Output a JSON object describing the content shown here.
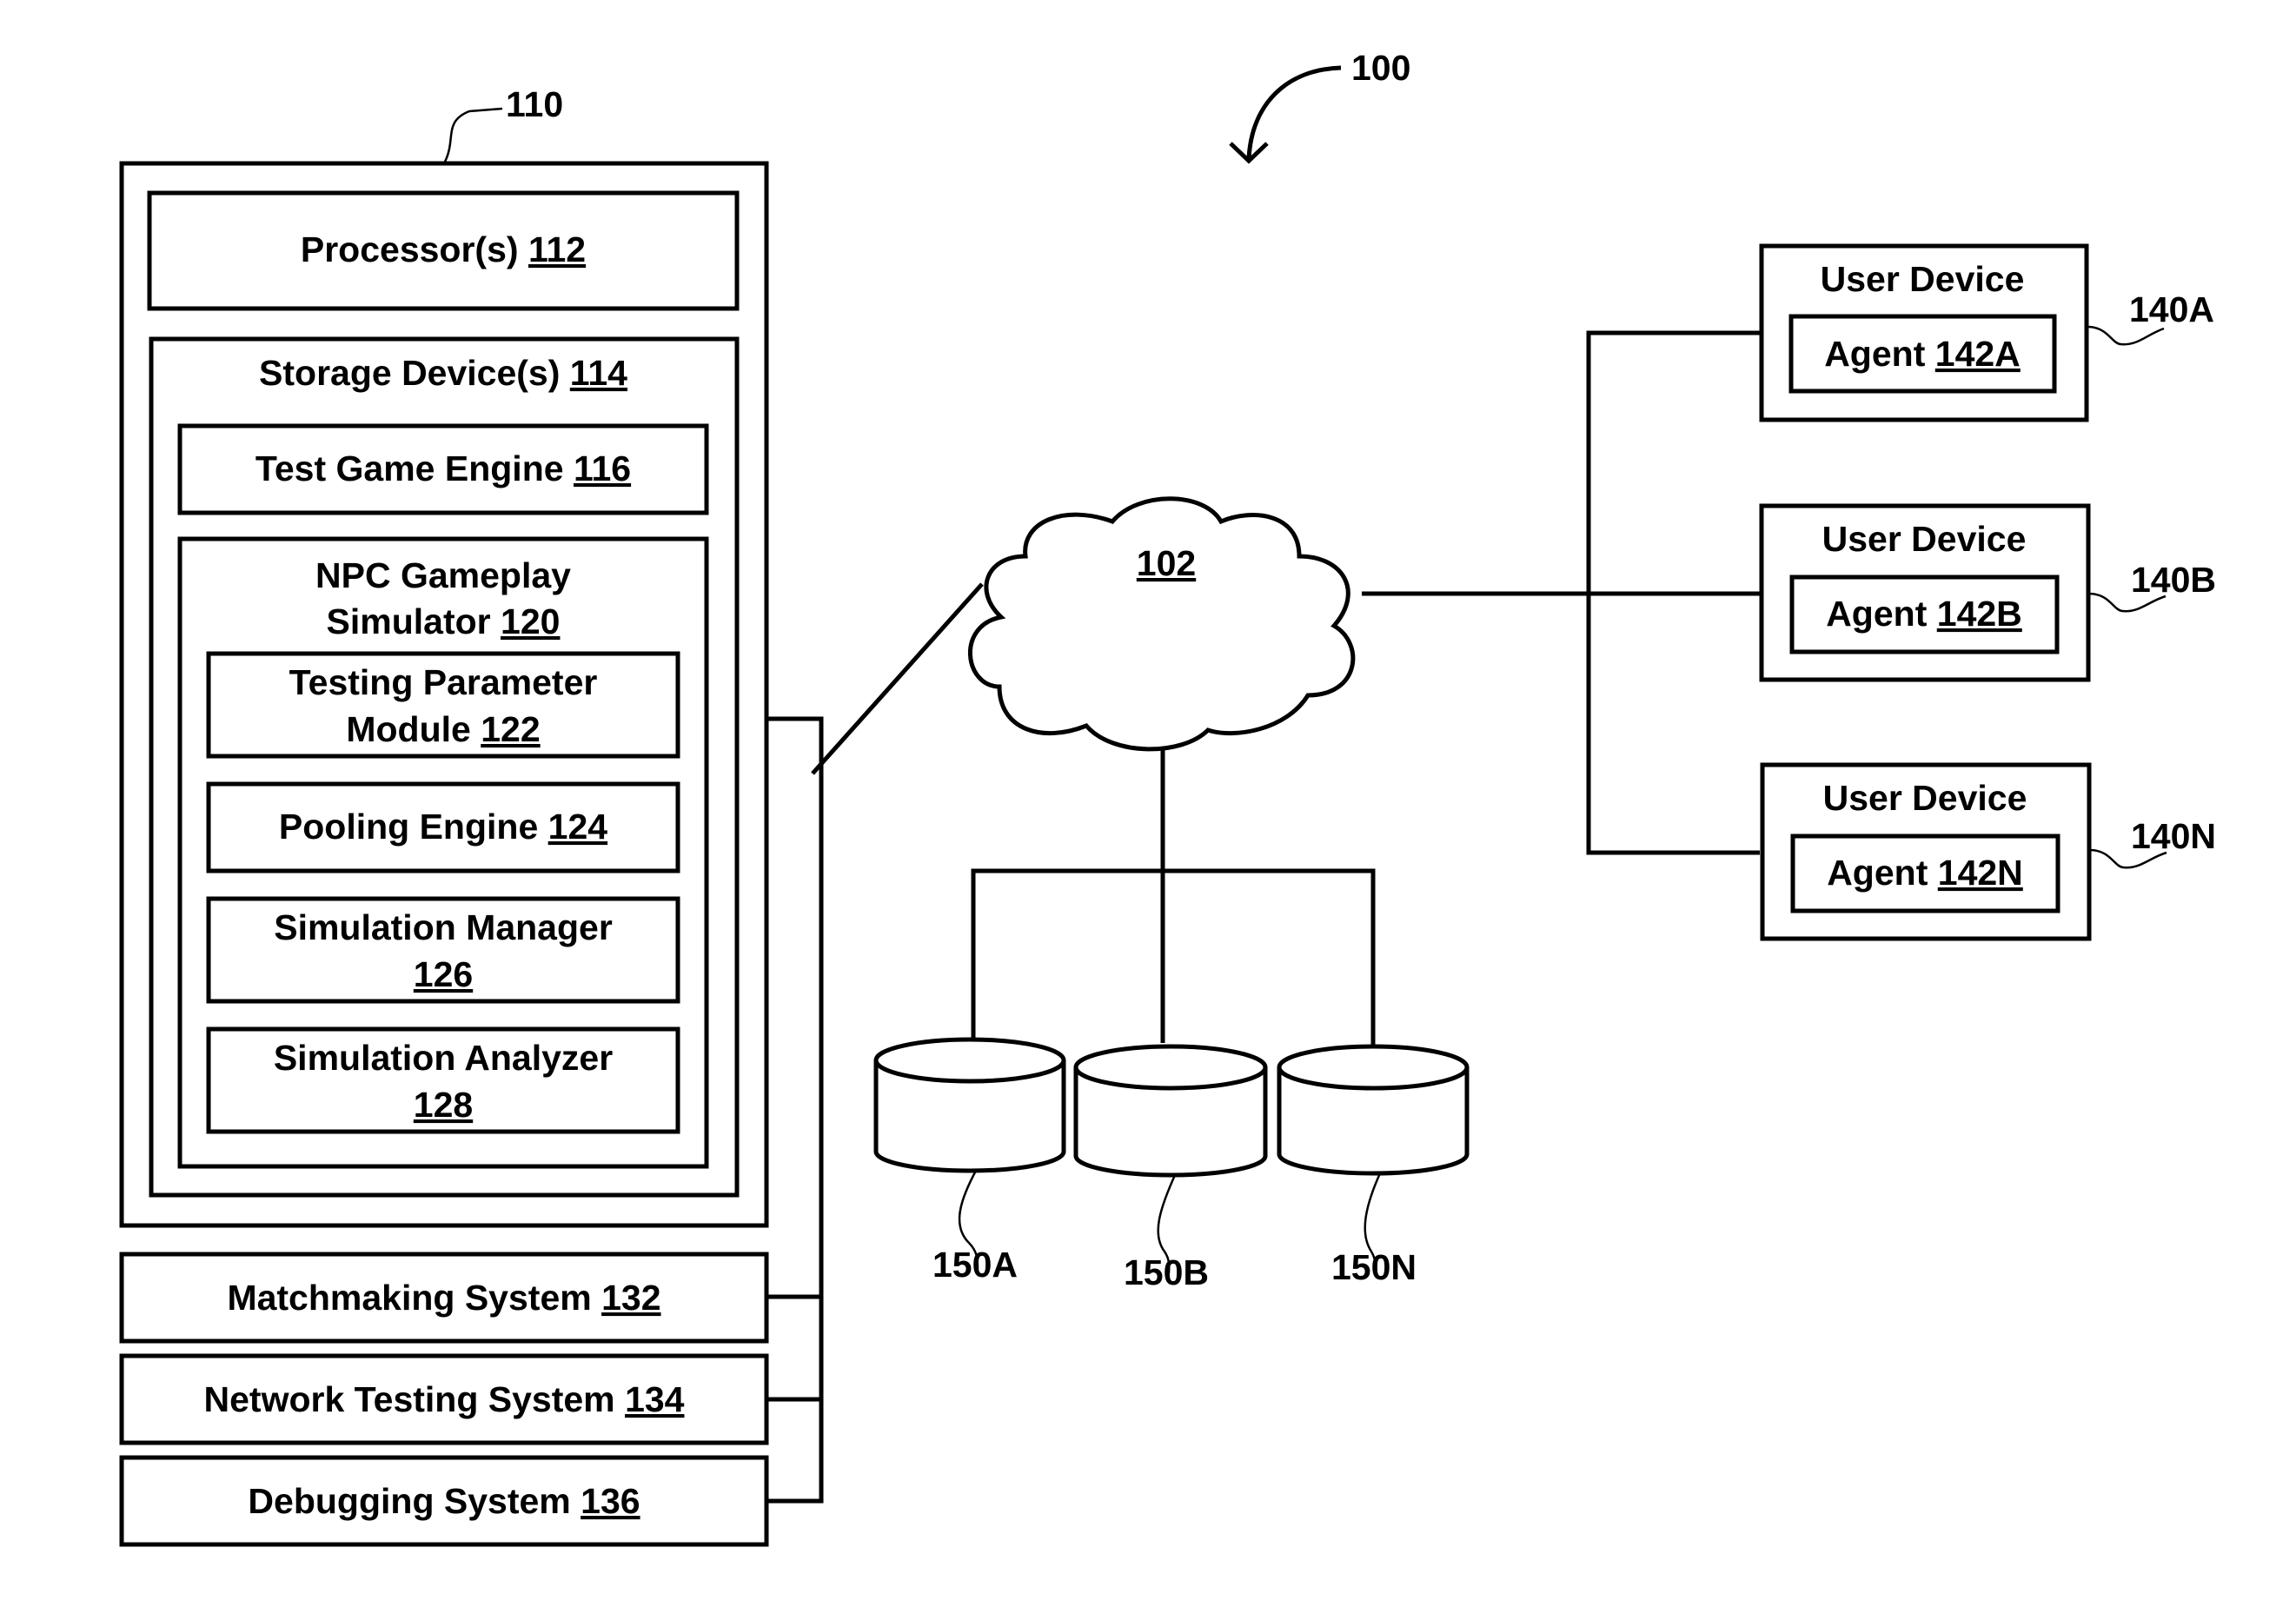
{
  "figure": {
    "ref": "100",
    "colors": {
      "ink": "#000000",
      "background": "#ffffff"
    }
  },
  "server": {
    "ref": "110",
    "processor": {
      "label": "Processor(s)",
      "ref": "112"
    },
    "storage": {
      "label": "Storage Device(s)",
      "ref": "114",
      "test_game_engine": {
        "label": "Test Game Engine",
        "ref": "116"
      },
      "npc_simulator": {
        "label_line1": "NPC Gameplay",
        "label_line2": "Simulator",
        "ref": "120",
        "modules": [
          {
            "line1": "Testing Parameter",
            "line2": "Module",
            "ref": "122"
          },
          {
            "line1": "Pooling Engine",
            "line2": "",
            "ref": "124"
          },
          {
            "line1": "Simulation Manager",
            "line2": "",
            "ref": "126"
          },
          {
            "line1": "Simulation Analyzer",
            "line2": "",
            "ref": "128"
          }
        ]
      }
    }
  },
  "systems": [
    {
      "label": "Matchmaking System",
      "ref": "132"
    },
    {
      "label": "Network Testing System",
      "ref": "134"
    },
    {
      "label": "Debugging System",
      "ref": "136"
    }
  ],
  "network": {
    "ref": "102"
  },
  "databases": [
    {
      "ref": "150A"
    },
    {
      "ref": "150B"
    },
    {
      "ref": "150N"
    }
  ],
  "user_devices": [
    {
      "label": "User Device",
      "agent_label": "Agent",
      "agent_ref": "142A",
      "ref": "140A"
    },
    {
      "label": "User Device",
      "agent_label": "Agent",
      "agent_ref": "142B",
      "ref": "140B"
    },
    {
      "label": "User Device",
      "agent_label": "Agent",
      "agent_ref": "142N",
      "ref": "140N"
    }
  ]
}
